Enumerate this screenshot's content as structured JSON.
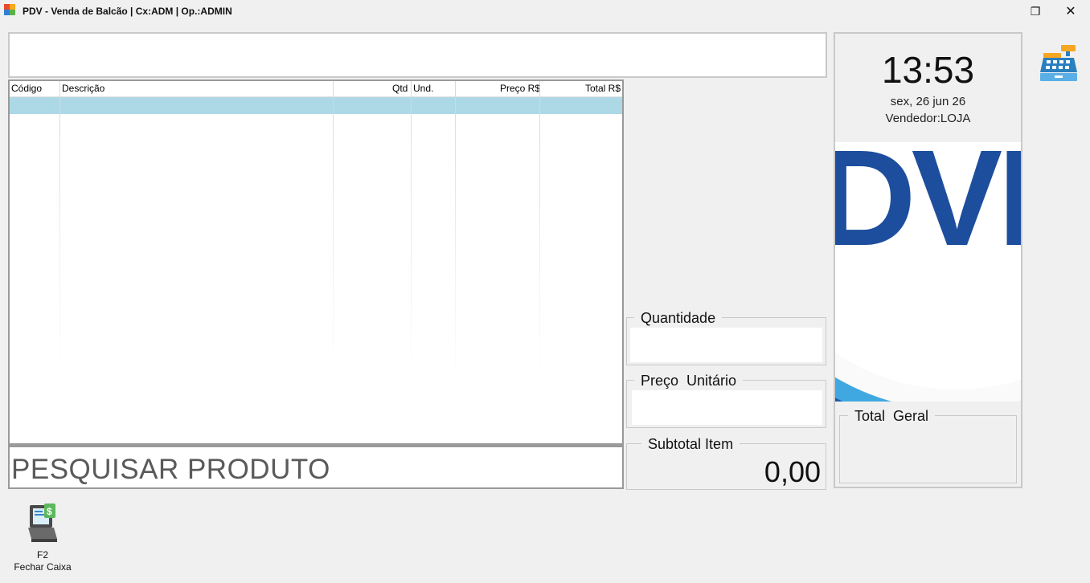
{
  "window": {
    "title": "PDV - Venda de Balcão | Cx:ADM | Op.:ADMIN",
    "restore_glyph": "❐",
    "close_glyph": "✕"
  },
  "grid": {
    "columns": [
      "Código",
      "Descrição",
      "Qtd",
      "Und.",
      "Preço R$",
      "Total R$"
    ],
    "selection_color": "#add8e6"
  },
  "search": {
    "placeholder": "PESQUISAR PRODUTO"
  },
  "fields": {
    "quantity_label": "Quantidade",
    "unit_price_label": "Preço  Unitário",
    "subtotal_label": "Subtotal Item",
    "subtotal_value": "0,00",
    "total_label": "Total  Geral"
  },
  "side": {
    "time": "13:53",
    "date": "sex, 26 jun 26",
    "seller": "Vendedor:LOJA",
    "logo_text": "DVI",
    "logo_color": "#1d4e9e"
  },
  "shortcuts": [
    {
      "key": "F2",
      "label": "Fechar Caixa",
      "icon": "cash-register-monitor-icon"
    }
  ],
  "colors": {
    "background": "#f0f0f0",
    "accent_blue": "#1d4e9e",
    "ring_light": "#3fa8e0"
  }
}
